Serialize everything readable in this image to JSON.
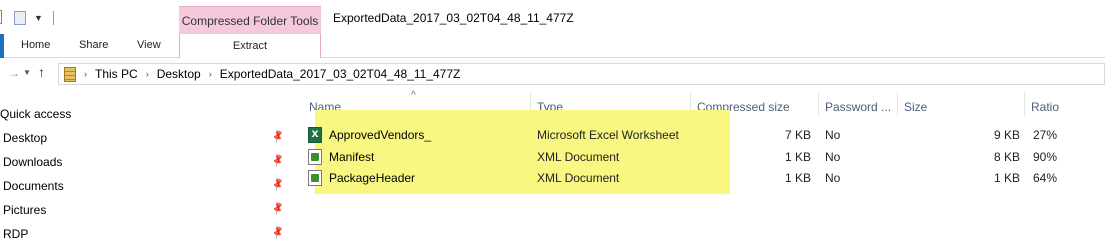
{
  "window": {
    "title": "ExportedData_2017_03_02T04_48_11_477Z",
    "context_group": "Compressed Folder Tools"
  },
  "ribbon": {
    "tabs": [
      {
        "label": "Home"
      },
      {
        "label": "Share"
      },
      {
        "label": "View"
      }
    ],
    "context_tab": "Extract"
  },
  "address": {
    "crumbs": [
      "This PC",
      "Desktop",
      "ExportedData_2017_03_02T04_48_11_477Z"
    ]
  },
  "nav": {
    "heading": "Quick access",
    "items": [
      {
        "label": "Desktop",
        "pinned": true
      },
      {
        "label": "Downloads",
        "pinned": true
      },
      {
        "label": "Documents",
        "pinned": true
      },
      {
        "label": "Pictures",
        "pinned": true
      },
      {
        "label": "RDP",
        "pinned": true
      }
    ]
  },
  "columns": {
    "name": "Name",
    "type": "Type",
    "compressed": "Compressed size",
    "password": "Password ...",
    "size": "Size",
    "ratio": "Ratio"
  },
  "files": [
    {
      "name": "ApprovedVendors_",
      "type": "Microsoft Excel Worksheet",
      "compressed": "7 KB",
      "password": "No",
      "size": "9 KB",
      "ratio": "27%",
      "icon": "excel-icon"
    },
    {
      "name": "Manifest",
      "type": "XML Document",
      "compressed": "1 KB",
      "password": "No",
      "size": "8 KB",
      "ratio": "90%",
      "icon": "xml-icon"
    },
    {
      "name": "PackageHeader",
      "type": "XML Document",
      "compressed": "1 KB",
      "password": "No",
      "size": "1 KB",
      "ratio": "64%",
      "icon": "xml-icon"
    }
  ],
  "colors": {
    "highlight": "#f7f782",
    "context_tab": "#f6c8dc",
    "column_header": "#4c607a"
  }
}
